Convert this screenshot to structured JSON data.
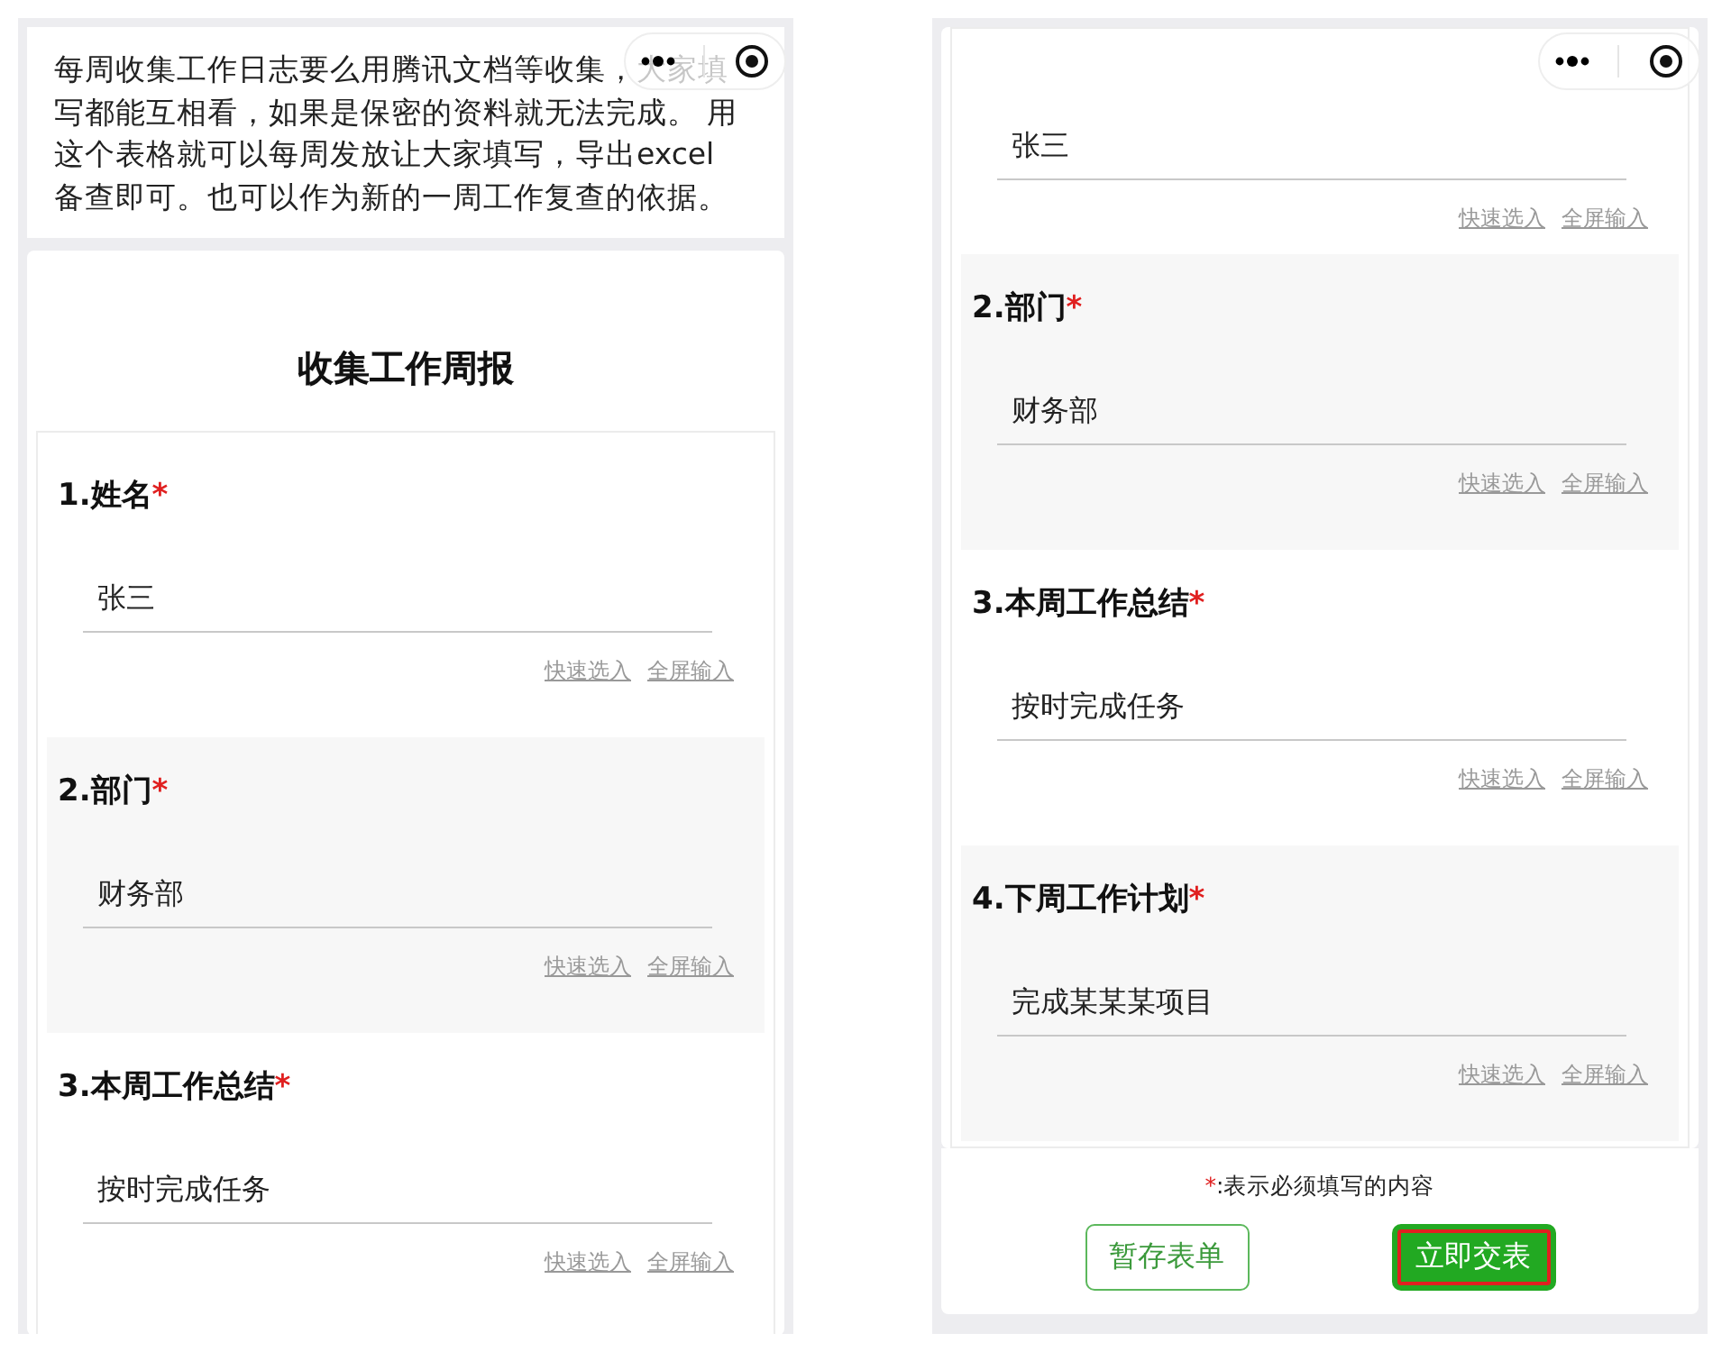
{
  "screens": [
    {
      "intro": "每周收集工作日志要么用腾讯文档等收集，大家填写都能互相看，如果是保密的资料就无法完成。 用这个表格就可以每周发放让大家填写，导出excel备查即可。也可以作为新的一周工作复查的依据。",
      "form_title": "收集工作周报",
      "questions": [
        {
          "label": "1.姓名",
          "required": true,
          "value": "张三",
          "links": [
            "快速选入",
            "全屏输入"
          ]
        },
        {
          "label": "2.部门",
          "required": true,
          "value": "财务部",
          "links": [
            "快速选入",
            "全屏输入"
          ]
        },
        {
          "label": "3.本周工作总结",
          "required": true,
          "value": "按时完成任务",
          "links": [
            "快速选入",
            "全屏输入"
          ]
        }
      ]
    },
    {
      "questions": [
        {
          "value": "张三",
          "links": [
            "快速选入",
            "全屏输入"
          ]
        },
        {
          "label": "2.部门",
          "required": true,
          "value": "财务部",
          "links": [
            "快速选入",
            "全屏输入"
          ]
        },
        {
          "label": "3.本周工作总结",
          "required": true,
          "value": "按时完成任务",
          "links": [
            "快速选入",
            "全屏输入"
          ]
        },
        {
          "label": "4.下周工作计划",
          "required": true,
          "value": "完成某某某项目",
          "links": [
            "快速选入",
            "全屏输入"
          ]
        }
      ],
      "required_note": {
        "mark": "*",
        "text": ":表示必须填写的内容"
      },
      "buttons": [
        {
          "label": "暂存表单",
          "kind": "outline",
          "highlighted": false
        },
        {
          "label": "立即交表",
          "kind": "filled",
          "highlighted": true
        }
      ]
    }
  ]
}
